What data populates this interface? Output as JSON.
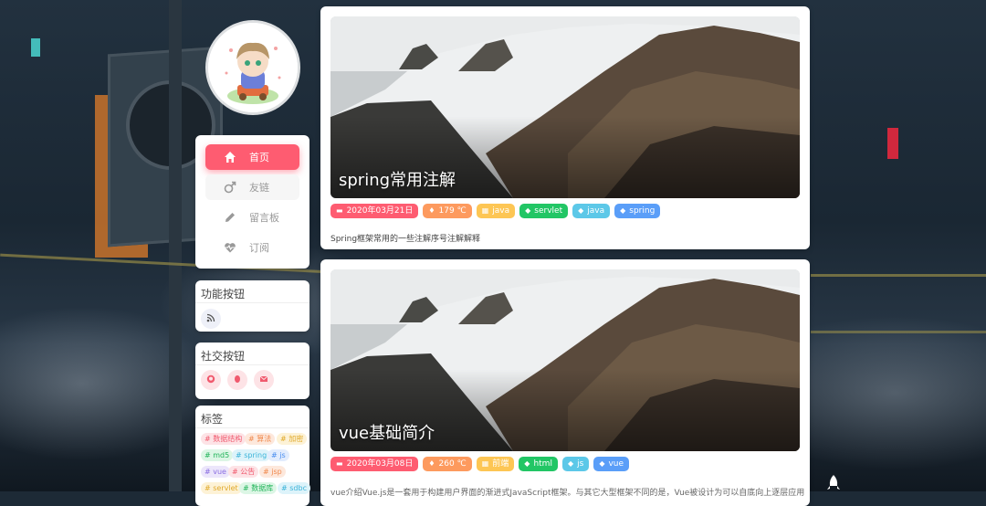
{
  "nav": {
    "items": [
      {
        "label": "首页",
        "icon": "home-icon",
        "active": true
      },
      {
        "label": "友链",
        "icon": "male-icon",
        "active": false
      },
      {
        "label": "留言板",
        "icon": "pencil-icon",
        "active": false
      },
      {
        "label": "订阅",
        "icon": "heartbeat-icon",
        "active": false
      }
    ]
  },
  "function_panel": {
    "title": "功能按钮",
    "buttons": [
      "rss-icon"
    ]
  },
  "social_panel": {
    "title": "社交按钮",
    "buttons": [
      "github-icon",
      "qq-icon",
      "mail-icon"
    ]
  },
  "tags_panel": {
    "title": "标签",
    "tags": [
      "# 数据结构",
      "# 算法",
      "# 加密",
      "# md5",
      "# spring",
      "# js",
      "# vue",
      "# 公告",
      "# jsp",
      "# servlet",
      "# 数据库",
      "# sdbc"
    ]
  },
  "posts": [
    {
      "title": "spring常用注解",
      "date": "2020年03月21日",
      "views": "179 ℃",
      "category": "java",
      "tags": [
        "servlet",
        "java",
        "spring"
      ],
      "excerpt": "Spring框架常用的一些注解序号注解解释"
    },
    {
      "title": "vue基础简介",
      "date": "2020年03月08日",
      "views": "260 ℃",
      "category": "前端",
      "tags": [
        "html",
        "js",
        "vue"
      ],
      "excerpt": "vue介绍Vue.js是一套用于构建用户界面的渐进式JavaScript框架。与其它大型框架不同的是，Vue被设计为可以自底向上逐层应用"
    }
  ],
  "colors": {
    "accent": "#fe5c71",
    "date_badge": "#fe5c71",
    "views_badge": "#fd9a5e",
    "category_badge": "#fdc654",
    "tag_colors": [
      "#22c665",
      "#5cc8e8",
      "#5a9ef8"
    ]
  }
}
